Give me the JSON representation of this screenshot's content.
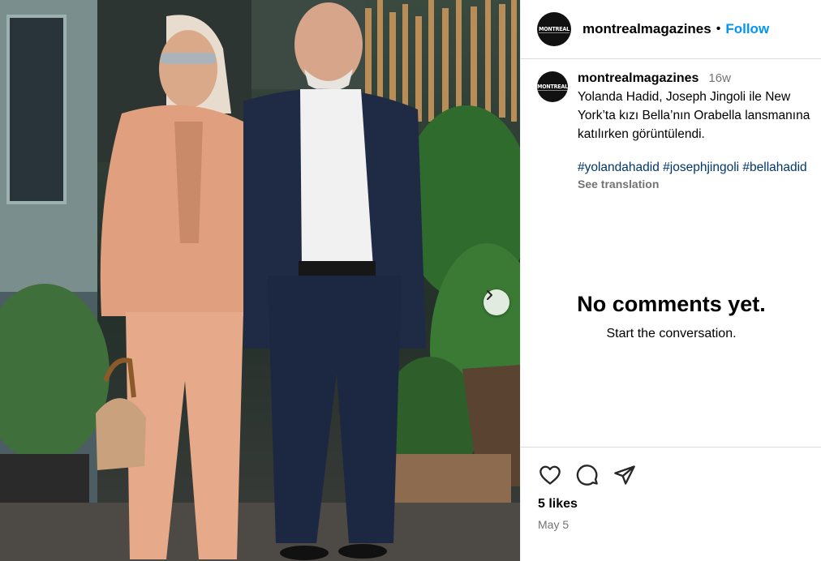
{
  "post": {
    "username": "montrealmagazines",
    "follow_label": "Follow",
    "separator": "•",
    "avatar_text": "MONTREAL",
    "caption": {
      "username": "montrealmagazines",
      "time": "16w",
      "lines": [
        "Yolanda Hadid, Joseph Jingoli ile New",
        "York’ta kızı Bella’nın Orabella lansmanına",
        "katılırken görüntülendi."
      ],
      "hashtags": "#yolandahadid #josephjingoli #bellahadid",
      "see_translation": "See translation"
    },
    "comments": {
      "empty_title": "No comments yet.",
      "empty_subtitle": "Start the conversation."
    },
    "likes": "5 likes",
    "date": "May 5",
    "icons": {
      "like": "heart-icon",
      "comment": "comment-icon",
      "share": "share-icon",
      "next": "chevron-right-icon"
    }
  },
  "photo": {
    "description_color_bg": "#2f3b33",
    "woman_suit_color": "#e0a07f",
    "man_jacket_color": "#1f2a44"
  }
}
